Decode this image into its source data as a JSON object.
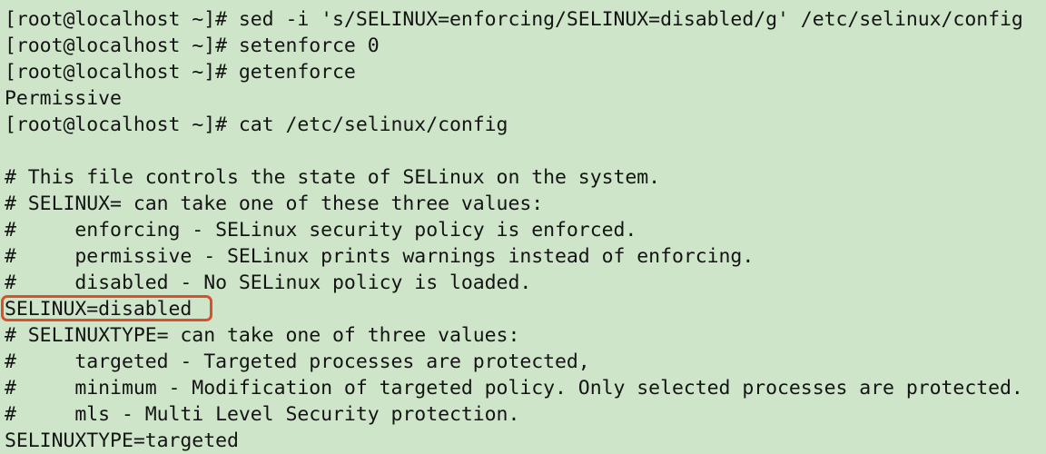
{
  "terminal": {
    "background_color": "#cee5c9",
    "text_color": "#141414",
    "highlight_color": "#d9502c",
    "prompt": "[root@localhost ~]#",
    "lines": [
      {
        "id": "cmd-sed",
        "text": "[root@localhost ~]# sed -i 's/SELINUX=enforcing/SELINUX=disabled/g' /etc/selinux/config"
      },
      {
        "id": "cmd-setenforce",
        "text": "[root@localhost ~]# setenforce 0"
      },
      {
        "id": "cmd-getenforce",
        "text": "[root@localhost ~]# getenforce"
      },
      {
        "id": "out-permissive",
        "text": "Permissive"
      },
      {
        "id": "cmd-cat",
        "text": "[root@localhost ~]# cat /etc/selinux/config"
      },
      {
        "id": "blank-1",
        "text": ""
      },
      {
        "id": "comment-intro",
        "text": "# This file controls the state of SELinux on the system."
      },
      {
        "id": "comment-selinux",
        "text": "# SELINUX= can take one of these three values:"
      },
      {
        "id": "comment-enforcing",
        "text": "#     enforcing - SELinux security policy is enforced."
      },
      {
        "id": "comment-permissive",
        "text": "#     permissive - SELinux prints warnings instead of enforcing."
      },
      {
        "id": "comment-disabled",
        "text": "#     disabled - No SELinux policy is loaded."
      },
      {
        "id": "setting-selinux",
        "text": "SELINUX=disabled",
        "highlighted": true
      },
      {
        "id": "comment-type",
        "text": "# SELINUXTYPE= can take one of three values:"
      },
      {
        "id": "comment-targeted",
        "text": "#     targeted - Targeted processes are protected,"
      },
      {
        "id": "comment-minimum",
        "text": "#     minimum - Modification of targeted policy. Only selected processes are protected."
      },
      {
        "id": "comment-mls",
        "text": "#     mls - Multi Level Security protection."
      },
      {
        "id": "setting-type",
        "text": "SELINUXTYPE=targeted"
      }
    ]
  }
}
